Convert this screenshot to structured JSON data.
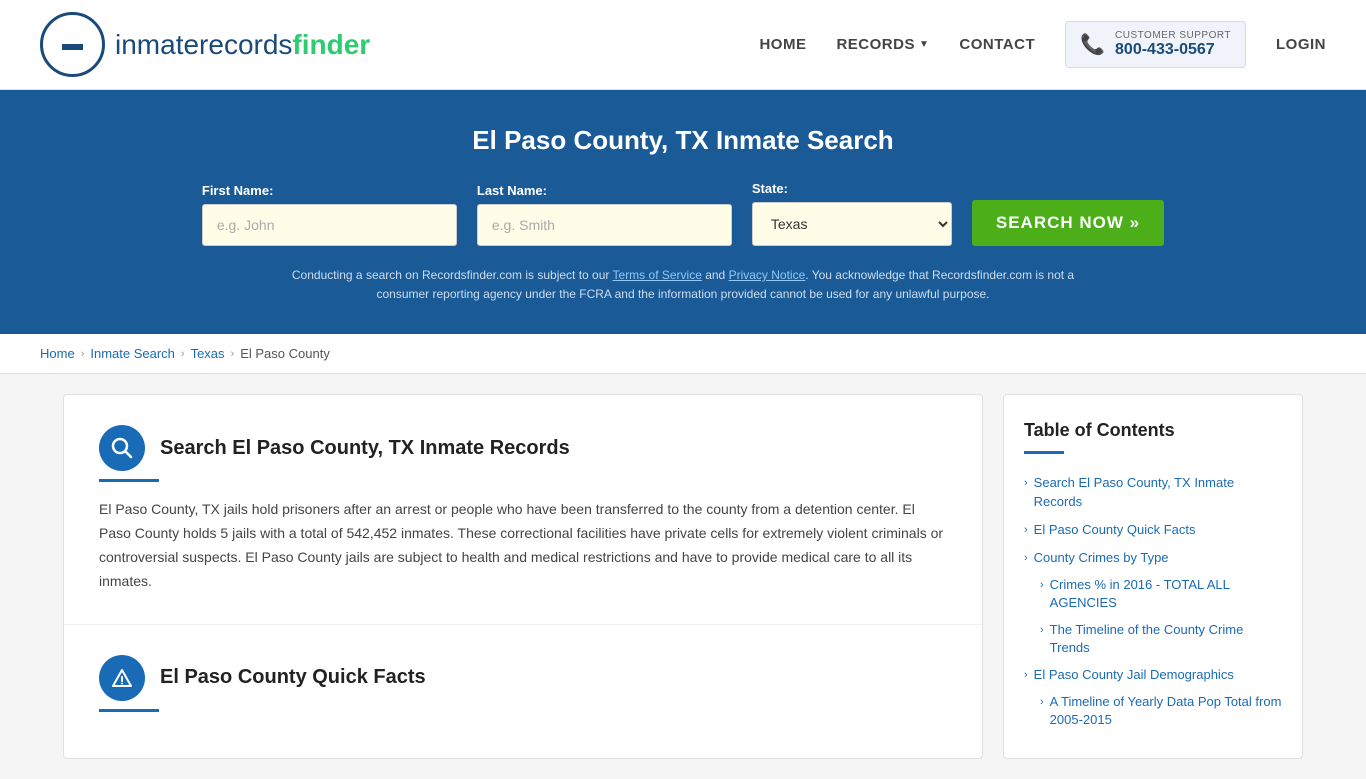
{
  "header": {
    "logo_text_main": "inmaterecords",
    "logo_text_accent": "finder",
    "nav": {
      "home": "HOME",
      "records": "RECORDS",
      "contact": "CONTACT",
      "login": "LOGIN"
    },
    "support": {
      "label": "CUSTOMER SUPPORT",
      "phone": "800-433-0567"
    }
  },
  "hero": {
    "title": "El Paso County, TX Inmate Search",
    "first_name_label": "First Name:",
    "first_name_placeholder": "e.g. John",
    "last_name_label": "Last Name:",
    "last_name_placeholder": "e.g. Smith",
    "state_label": "State:",
    "state_value": "Texas",
    "search_btn": "SEARCH NOW »",
    "disclaimer": "Conducting a search on Recordsfinder.com is subject to our Terms of Service and Privacy Notice. You acknowledge that Recordsfinder.com is not a consumer reporting agency under the FCRA and the information provided cannot be used for any unlawful purpose.",
    "disclaimer_link1": "Terms of Service",
    "disclaimer_link2": "Privacy Notice"
  },
  "breadcrumb": {
    "home": "Home",
    "inmate_search": "Inmate Search",
    "state": "Texas",
    "county": "El Paso County"
  },
  "main": {
    "section1": {
      "title": "Search El Paso County, TX Inmate Records",
      "icon": "🔍",
      "body": "El Paso County, TX jails hold prisoners after an arrest or people who have been transferred to the county from a detention center. El Paso County holds 5 jails with a total of 542,452 inmates. These correctional facilities have private cells for extremely violent criminals or controversial suspects. El Paso County jails are subject to health and medical restrictions and have to provide medical care to all its inmates."
    },
    "section2": {
      "title": "El Paso County Quick Facts",
      "icon": "⚠"
    }
  },
  "toc": {
    "title": "Table of Contents",
    "items": [
      {
        "label": "Search El Paso County, TX Inmate Records",
        "sub": false
      },
      {
        "label": "El Paso County Quick Facts",
        "sub": false
      },
      {
        "label": "County Crimes by Type",
        "sub": false
      },
      {
        "label": "Crimes % in 2016 - TOTAL ALL AGENCIES",
        "sub": true
      },
      {
        "label": "The Timeline of the County Crime Trends",
        "sub": true
      },
      {
        "label": "El Paso County Jail Demographics",
        "sub": false
      },
      {
        "label": "A Timeline of Yearly Data Pop Total from 2005-2015",
        "sub": true
      }
    ]
  }
}
